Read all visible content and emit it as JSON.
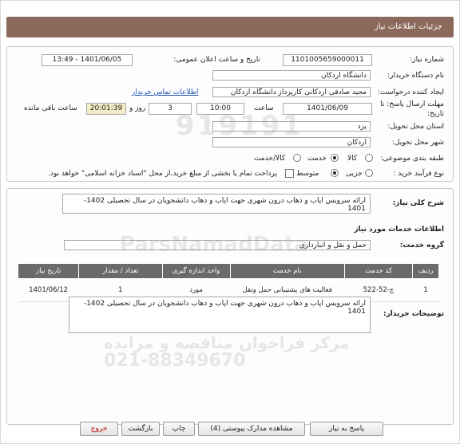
{
  "header": {
    "title": "جزئیات اطلاعات نیاز"
  },
  "form": {
    "need_number_label": "شماره نیاز:",
    "need_number": "1101005659000011",
    "announce_label": "تاریخ و ساعت اعلان عمومی:",
    "announce_value": "1401/06/05 - 13:49",
    "buyer_org_label": "نام دستگاه خریدار:",
    "buyer_org": "دانشگاه اردکان",
    "creator_label": "ایجاد کننده درخواست:",
    "creator": "مجید صادقی اردکانی کارپرداز دانشگاه اردکان",
    "contact_link": "اطلاعات تماس خریدار",
    "deadline_label_1": "مهلت ارسال پاسخ: تا",
    "deadline_label_2": "تاریخ:",
    "deadline_date": "1401/06/09",
    "time_label": "ساعت",
    "deadline_time": "10:00",
    "days_value": "3",
    "days_label": "روز و",
    "remaining_time": "20:01:39",
    "remaining_label": "ساعت باقی مانده",
    "province_label": "استان محل تحویل:",
    "province": "یزد",
    "city_label": "شهر محل تحویل:",
    "city": "اردکان",
    "category_label": "طبقه بندی موضوعی:",
    "category_options": [
      "کالا",
      "خدمت",
      "کالا/خدمت"
    ],
    "category_selected": "خدمت",
    "process_label": "نوع فرآیند خرید :",
    "process_options": [
      "جزیی",
      "متوسط"
    ],
    "process_selected": "متوسط",
    "payment_note": "پرداخت تمام یا بخشی از مبلغ خرید،از محل \"اسناد خزانه اسلامی\" خواهد بود."
  },
  "summary": {
    "label": "شرح کلی نیاز:",
    "text": "ارائه سرویس اپاب و ذهاب درون شهری جهت اپاب و ذهاب دانشجویان در سال تحصیلی 1402-1401"
  },
  "services": {
    "section_title": "اطلاعات خدمات مورد نیاز",
    "group_label": "گروه خدمت:",
    "group_value": "حمل و نقل و انبارداری",
    "table_headers": [
      "ردیف",
      "کد خدمت",
      "نام خدمت",
      "واحد اندازه گیری",
      "تعداد / مقدار",
      "تاریخ نیاز"
    ],
    "rows": [
      {
        "row": "1",
        "code": "ج-52-522",
        "name": "فعالیت های پشتیبانی حمل ونقل",
        "unit": "مورد",
        "qty": "1",
        "date": "1401/06/12"
      }
    ],
    "buyer_notes_label": "توضیحات خریدار:",
    "buyer_notes": "ارائه سرویس اپاب و ذهاب درون شهری جهت اپاب و ذهاب دانشجویان در سال تحصیلی 1402-1401"
  },
  "buttons": {
    "reply": "پاسخ به نیاز",
    "attachments": "مشاهده مدارک پیوستی (4)",
    "print": "چاپ",
    "back": "بازگشت",
    "exit": "خروج"
  },
  "watermark": {
    "line1": "ParsNamadData",
    "line2": "021-88349670",
    "line3": "مرکز فراخوان مناقصه و مزایده"
  }
}
